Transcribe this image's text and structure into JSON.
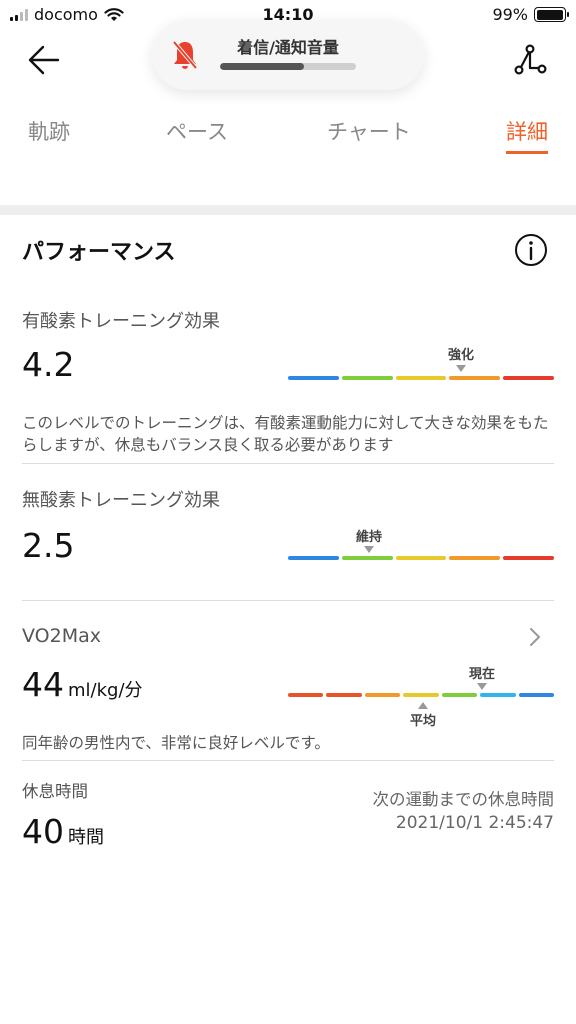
{
  "status_bar": {
    "carrier": "docomo",
    "time": "14:10",
    "battery": "99%",
    "battery_level": 0.99
  },
  "volume_overlay": {
    "label": "着信/通知音量",
    "level": 0.62
  },
  "tabs": [
    {
      "label": "軌跡"
    },
    {
      "label": "ペース"
    },
    {
      "label": "チャート"
    },
    {
      "label": "詳細"
    }
  ],
  "section": {
    "title": "パフォーマンス"
  },
  "aerobic": {
    "label": "有酸素トレーニング効果",
    "value": "4.2",
    "marker_label": "強化",
    "description": "このレベルでのトレーニングは、有酸素運動能力に対して大きな効果をもたらしますが、休息もバランス良く取る必要があります"
  },
  "anaerobic": {
    "label": "無酸素トレーニング効果",
    "value": "2.5",
    "marker_label": "維持"
  },
  "vo2max": {
    "label": "VO2Max",
    "value": "44",
    "unit": "ml/kg/分",
    "current_label": "現在",
    "average_label": "平均",
    "description": "同年齢の男性内で、非常に良好レベルです。"
  },
  "rest": {
    "label": "休息時間",
    "value": "40",
    "unit": "時間",
    "next_label": "次の運動までの休息時間",
    "next_value": "2021/10/1 2:45:47"
  },
  "colors": {
    "accent": "#f0622a",
    "blue": "#2f86e0",
    "red_orange": "#e8542a",
    "orange": "#f2992b",
    "green": "#7ccf3a",
    "yellow": "#e8c92c",
    "teal": "#2fb6e6",
    "red": "#e63a2a"
  },
  "icons": {
    "back": "arrow-left-icon",
    "share": "share-graph-icon",
    "mute": "bell-muted-icon",
    "info": "info-circle-icon",
    "chevron": "chevron-right-icon"
  }
}
